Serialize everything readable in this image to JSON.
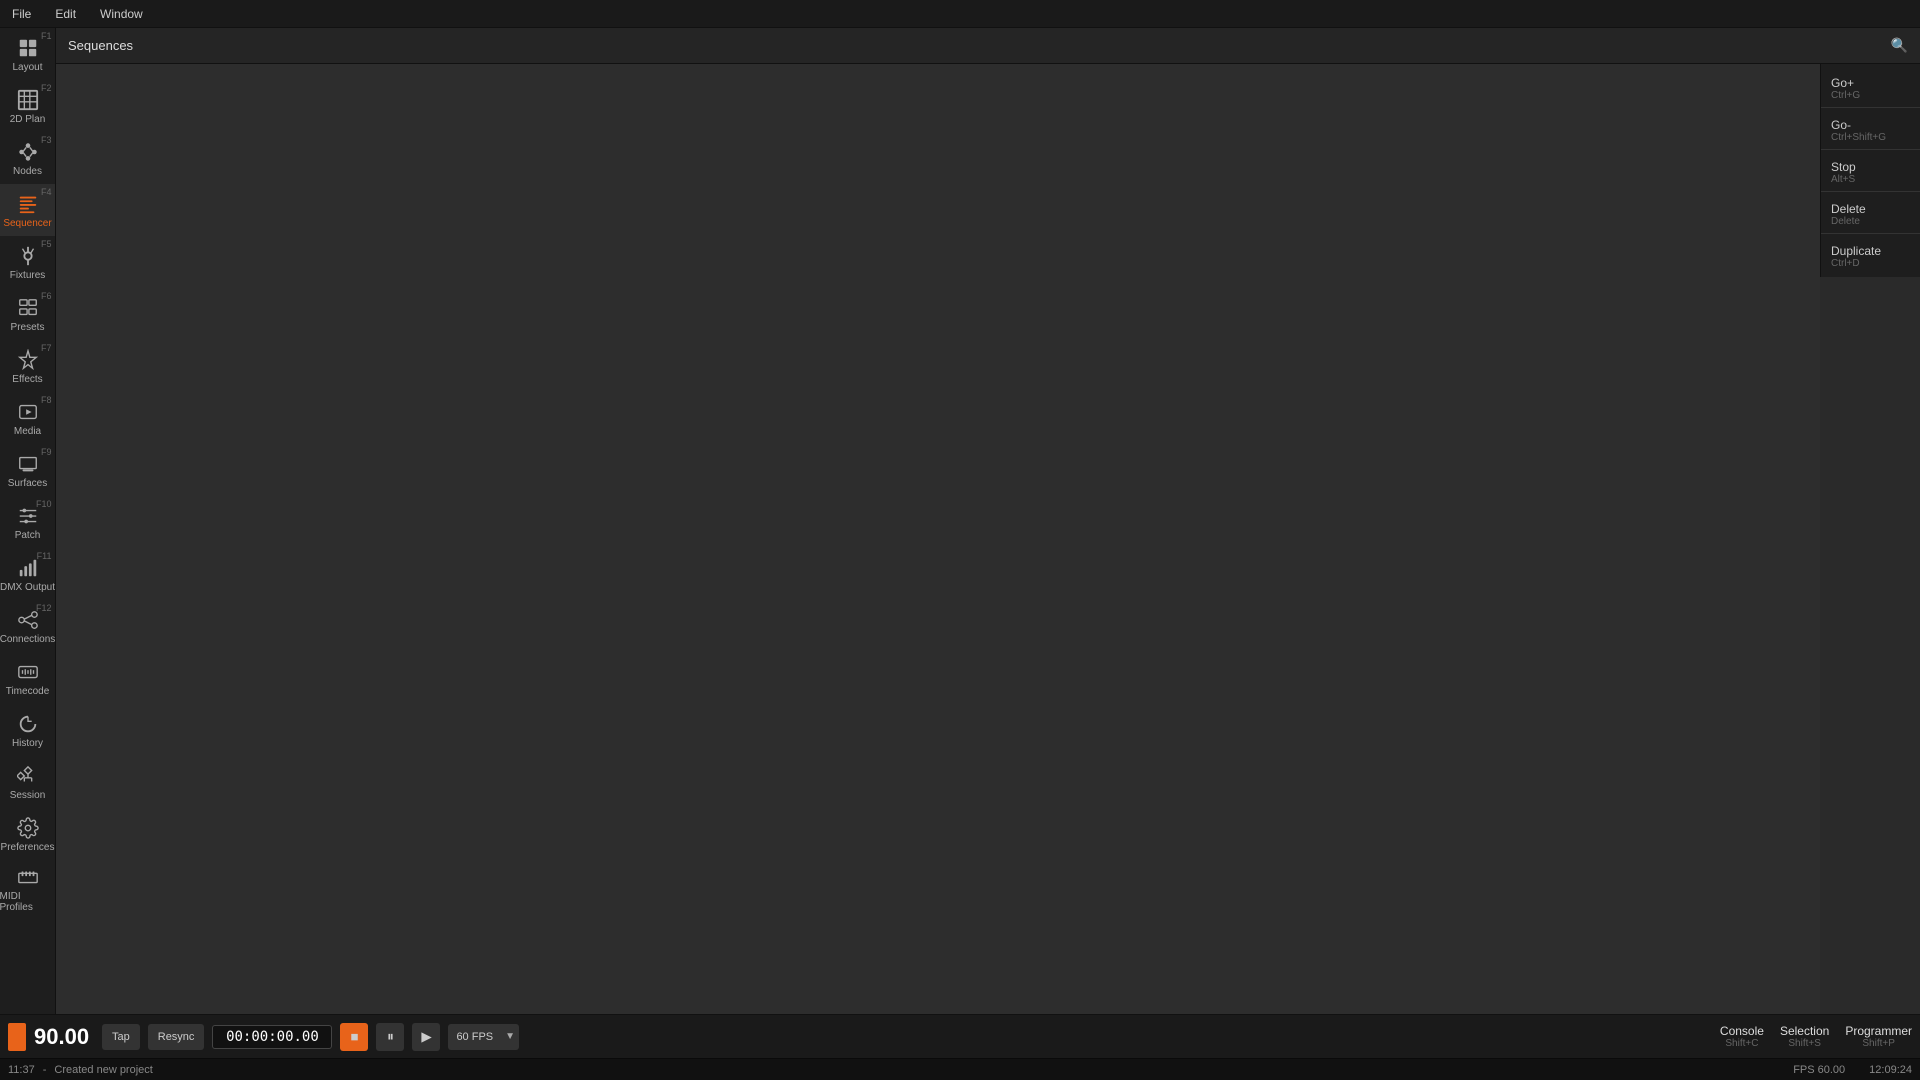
{
  "menubar": {
    "items": [
      "File",
      "Edit",
      "Window"
    ]
  },
  "toolbar": {
    "title": "Sequences",
    "search_icon": "🔍"
  },
  "sidebar": {
    "items": [
      {
        "label": "Layout",
        "fkey": "F1",
        "icon": "layout",
        "active": false
      },
      {
        "label": "2D Plan",
        "fkey": "F2",
        "icon": "plan",
        "active": false
      },
      {
        "label": "Nodes",
        "fkey": "F3",
        "icon": "nodes",
        "active": false
      },
      {
        "label": "Sequencer",
        "fkey": "F4",
        "icon": "sequencer",
        "active": true
      },
      {
        "label": "Fixtures",
        "fkey": "F5",
        "icon": "fixtures",
        "active": false
      },
      {
        "label": "Presets",
        "fkey": "F6",
        "icon": "presets",
        "active": false
      },
      {
        "label": "Effects",
        "fkey": "F7",
        "icon": "effects",
        "active": false
      },
      {
        "label": "Media",
        "fkey": "F8",
        "icon": "media",
        "active": false
      },
      {
        "label": "Surfaces",
        "fkey": "F9",
        "icon": "surfaces",
        "active": false
      },
      {
        "label": "Patch",
        "fkey": "F10",
        "icon": "patch",
        "active": false
      },
      {
        "label": "DMX Output",
        "fkey": "F11",
        "icon": "dmx",
        "active": false
      },
      {
        "label": "Connections",
        "fkey": "F12",
        "icon": "connections",
        "active": false
      },
      {
        "label": "Timecode",
        "fkey": "",
        "icon": "timecode",
        "active": false
      },
      {
        "label": "History",
        "fkey": "",
        "icon": "history",
        "active": false
      },
      {
        "label": "Session",
        "fkey": "",
        "icon": "session",
        "active": false
      },
      {
        "label": "Preferences",
        "fkey": "",
        "icon": "preferences",
        "active": false
      },
      {
        "label": "MIDI Profiles",
        "fkey": "",
        "icon": "midi",
        "active": false
      }
    ]
  },
  "right_panel": {
    "actions": [
      {
        "label": "Go+",
        "shortcut": "Ctrl+G"
      },
      {
        "label": "Go-",
        "shortcut": "Ctrl+Shift+G"
      },
      {
        "label": "Stop",
        "shortcut": "Alt+S"
      },
      {
        "label": "Delete",
        "shortcut": "Delete"
      },
      {
        "label": "Duplicate",
        "shortcut": "Ctrl+D"
      }
    ]
  },
  "transport": {
    "bpm": "90.00",
    "tap_label": "Tap",
    "resync_label": "Resync",
    "timecode": "00:00:00.00",
    "stop_icon": "■",
    "pause_icon": "⏸",
    "play_icon": "▶",
    "fps_value": "60 FPS",
    "modes": [
      {
        "label": "Console",
        "shortcut": "Shift+C"
      },
      {
        "label": "Selection",
        "shortcut": "Shift+S"
      },
      {
        "label": "Programmer",
        "shortcut": "Shift+P"
      }
    ]
  },
  "statusbar": {
    "time": "11:37",
    "message": "Created new project",
    "fps": "FPS 60.00",
    "clock": "12:09:24"
  }
}
